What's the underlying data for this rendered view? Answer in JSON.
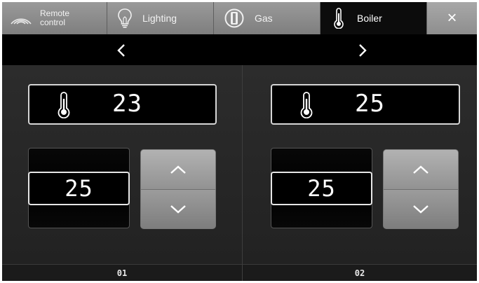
{
  "tabs": {
    "remote": {
      "label_line1": "Remote",
      "label_line2": "control",
      "icon": "wifi-signal-icon"
    },
    "lighting": {
      "label": "Lighting",
      "icon": "lightbulb-icon"
    },
    "gas": {
      "label": "Gas",
      "icon": "gas-valve-icon"
    },
    "boiler": {
      "label": "Boiler",
      "icon": "thermometer-icon",
      "active": true
    },
    "close": {
      "label": "×",
      "icon": "close-icon"
    }
  },
  "nav": {
    "prev": "‹",
    "next": "›"
  },
  "zones": [
    {
      "current_temp": "23",
      "setpoint": "25",
      "footer_label": "01"
    },
    {
      "current_temp": "25",
      "setpoint": "25",
      "footer_label": "02"
    }
  ],
  "colors": {
    "tab_bg": "#8e8e8e",
    "tab_active_bg": "#0c0c0c",
    "panel_bg": "#262626",
    "display_bg": "#000000",
    "display_border": "#d6d6d6",
    "text": "#ffffff"
  }
}
